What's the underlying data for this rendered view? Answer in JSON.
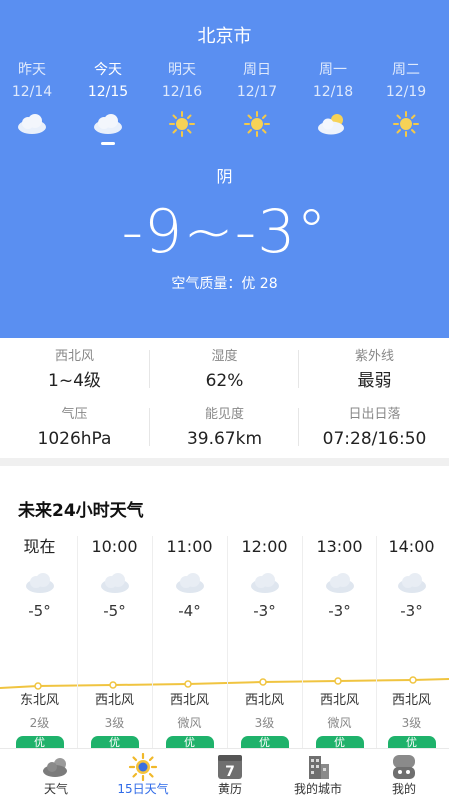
{
  "header": {
    "city": "北京市"
  },
  "days": [
    {
      "name": "昨天",
      "date": "12/14",
      "icon": "cloud-icon",
      "active": false
    },
    {
      "name": "今天",
      "date": "12/15",
      "icon": "cloud-icon",
      "active": true
    },
    {
      "name": "明天",
      "date": "12/16",
      "icon": "sun-icon",
      "active": false
    },
    {
      "name": "周日",
      "date": "12/17",
      "icon": "sun-icon",
      "active": false
    },
    {
      "name": "周一",
      "date": "12/18",
      "icon": "partly-cloudy-icon",
      "active": false
    },
    {
      "name": "周二",
      "date": "12/19",
      "icon": "sun-icon",
      "active": false
    }
  ],
  "today": {
    "condition": "阴",
    "temperature": "-9~-3°",
    "air_quality": "空气质量：优 28"
  },
  "metrics": [
    {
      "label": "西北风",
      "value": "1~4级"
    },
    {
      "label": "湿度",
      "value": "62%"
    },
    {
      "label": "紫外线",
      "value": "最弱"
    },
    {
      "label": "气压",
      "value": "1026hPa"
    },
    {
      "label": "能见度",
      "value": "39.67km"
    },
    {
      "label": "日出日落",
      "value": "07:28/16:50"
    }
  ],
  "hourly": {
    "title": "未来24小时天气",
    "items": [
      {
        "time": "现在",
        "temp": "-5°",
        "wind": "东北风",
        "level": "2级",
        "aqi": "优",
        "icon": "cloud-icon"
      },
      {
        "time": "10:00",
        "temp": "-5°",
        "wind": "西北风",
        "level": "3级",
        "aqi": "优",
        "icon": "cloud-icon"
      },
      {
        "time": "11:00",
        "temp": "-4°",
        "wind": "西北风",
        "level": "微风",
        "aqi": "优",
        "icon": "cloud-icon"
      },
      {
        "time": "12:00",
        "temp": "-3°",
        "wind": "西北风",
        "level": "3级",
        "aqi": "优",
        "icon": "cloud-icon"
      },
      {
        "time": "13:00",
        "temp": "-3°",
        "wind": "西北风",
        "level": "微风",
        "aqi": "优",
        "icon": "cloud-icon"
      },
      {
        "time": "14:00",
        "temp": "-3°",
        "wind": "西北风",
        "level": "3级",
        "aqi": "优",
        "icon": "cloud-icon"
      }
    ]
  },
  "tabs": [
    {
      "label": "天气",
      "icon": "weather-icon",
      "active": false
    },
    {
      "label": "15日天气",
      "icon": "sun-icon",
      "active": true
    },
    {
      "label": "黄历",
      "icon": "calendar-icon",
      "active": false,
      "badge": "7"
    },
    {
      "label": "我的城市",
      "icon": "city-icon",
      "active": false
    },
    {
      "label": "我的",
      "icon": "profile-icon",
      "active": false
    }
  ],
  "colors": {
    "header_bg": "#5a8ff1",
    "aqi_good": "#1fb26b",
    "trend_line": "#f0c440",
    "tab_active": "#2f6be8"
  }
}
